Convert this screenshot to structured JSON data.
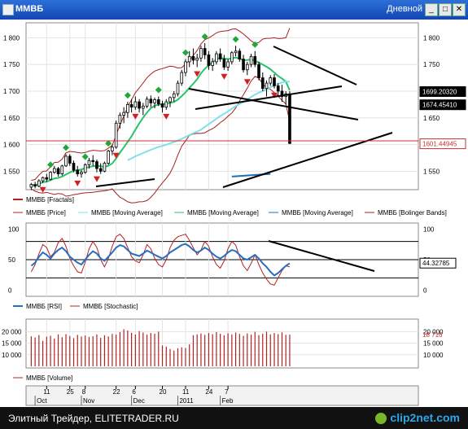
{
  "window": {
    "title": "ММВБ",
    "period": "Дневной"
  },
  "footer": {
    "text": "Элитный Трейдер, ELITETRADER.RU",
    "logo": "clip2net.com"
  },
  "chart_data": [
    {
      "type": "line",
      "name": "price",
      "y_ticks": [
        "1 800",
        "1 750",
        "1 700",
        "1 650",
        "1 600",
        "1 550"
      ],
      "y_tick_values": [
        1800,
        1750,
        1700,
        1650,
        1600,
        1550
      ],
      "ylim": [
        1520,
        1825
      ],
      "x_count": 100,
      "candles": [
        [
          1520,
          1528,
          1515,
          1525
        ],
        [
          1525,
          1530,
          1518,
          1522
        ],
        [
          1522,
          1535,
          1520,
          1532
        ],
        [
          1532,
          1540,
          1528,
          1538
        ],
        [
          1538,
          1545,
          1530,
          1535
        ],
        [
          1535,
          1550,
          1533,
          1548
        ],
        [
          1548,
          1560,
          1545,
          1555
        ],
        [
          1555,
          1558,
          1540,
          1545
        ],
        [
          1545,
          1562,
          1542,
          1560
        ],
        [
          1560,
          1582,
          1558,
          1578
        ],
        [
          1578,
          1582,
          1560,
          1565
        ],
        [
          1565,
          1570,
          1548,
          1552
        ],
        [
          1552,
          1560,
          1540,
          1545
        ],
        [
          1545,
          1552,
          1538,
          1548
        ],
        [
          1548,
          1565,
          1545,
          1562
        ],
        [
          1562,
          1575,
          1555,
          1570
        ],
        [
          1570,
          1580,
          1560,
          1568
        ],
        [
          1568,
          1572,
          1548,
          1555
        ],
        [
          1555,
          1565,
          1545,
          1550
        ],
        [
          1550,
          1568,
          1548,
          1565
        ],
        [
          1565,
          1590,
          1562,
          1588
        ],
        [
          1588,
          1600,
          1580,
          1595
        ],
        [
          1595,
          1645,
          1592,
          1640
        ],
        [
          1640,
          1660,
          1630,
          1655
        ],
        [
          1655,
          1670,
          1640,
          1660
        ],
        [
          1660,
          1680,
          1650,
          1675
        ],
        [
          1675,
          1685,
          1660,
          1670
        ],
        [
          1670,
          1690,
          1665,
          1680
        ],
        [
          1680,
          1685,
          1660,
          1668
        ],
        [
          1668,
          1678,
          1655,
          1672
        ],
        [
          1672,
          1690,
          1668,
          1685
        ],
        [
          1685,
          1692,
          1670,
          1678
        ],
        [
          1678,
          1688,
          1668,
          1684
        ],
        [
          1684,
          1690,
          1672,
          1676
        ],
        [
          1676,
          1682,
          1660,
          1670
        ],
        [
          1670,
          1685,
          1665,
          1680
        ],
        [
          1680,
          1690,
          1670,
          1688
        ],
        [
          1688,
          1700,
          1680,
          1695
        ],
        [
          1695,
          1720,
          1690,
          1715
        ],
        [
          1715,
          1740,
          1710,
          1735
        ],
        [
          1735,
          1760,
          1728,
          1755
        ],
        [
          1755,
          1775,
          1745,
          1765
        ],
        [
          1765,
          1780,
          1750,
          1758
        ],
        [
          1758,
          1770,
          1745,
          1762
        ],
        [
          1762,
          1785,
          1755,
          1780
        ],
        [
          1780,
          1790,
          1760,
          1768
        ],
        [
          1768,
          1775,
          1740,
          1748
        ],
        [
          1748,
          1762,
          1738,
          1755
        ],
        [
          1755,
          1775,
          1750,
          1770
        ],
        [
          1770,
          1780,
          1755,
          1760
        ],
        [
          1760,
          1768,
          1740,
          1745
        ],
        [
          1745,
          1760,
          1738,
          1755
        ],
        [
          1755,
          1775,
          1750,
          1772
        ],
        [
          1772,
          1785,
          1765,
          1775
        ],
        [
          1775,
          1780,
          1755,
          1760
        ],
        [
          1760,
          1768,
          1735,
          1740
        ],
        [
          1740,
          1755,
          1730,
          1750
        ],
        [
          1750,
          1770,
          1745,
          1765
        ],
        [
          1765,
          1775,
          1745,
          1750
        ],
        [
          1750,
          1755,
          1720,
          1725
        ],
        [
          1725,
          1735,
          1700,
          1705
        ],
        [
          1705,
          1720,
          1690,
          1715
        ],
        [
          1715,
          1730,
          1710,
          1725
        ],
        [
          1725,
          1732,
          1705,
          1710
        ],
        [
          1710,
          1715,
          1690,
          1700
        ],
        [
          1700,
          1712,
          1680,
          1690
        ],
        [
          1690,
          1700,
          1675,
          1695
        ],
        [
          1695,
          1700,
          1601,
          1602
        ]
      ],
      "fractals_up_idx": [
        5,
        9,
        14,
        20,
        25,
        33,
        40,
        45,
        53,
        58
      ],
      "fractals_down_idx": [
        3,
        12,
        17,
        22,
        27,
        35,
        43,
        50,
        56,
        63
      ],
      "price_labels": [
        "1699.20320",
        "1674.45410",
        "1601.44945"
      ],
      "price_label_values": [
        1699.2,
        1674.45,
        1601.45
      ]
    },
    {
      "type": "line",
      "name": "oscillators",
      "y_ticks": [
        "100",
        "50",
        "0"
      ],
      "y_tick_values": [
        100,
        50,
        0
      ],
      "ylim": [
        -5,
        105
      ],
      "levels": [
        80,
        50,
        20
      ],
      "value_label": "44.32785",
      "value": 44.33,
      "rsi": [
        40,
        45,
        55,
        62,
        58,
        52,
        60,
        66,
        70,
        64,
        55,
        50,
        45,
        42,
        50,
        58,
        64,
        60,
        52,
        48,
        55,
        62,
        70,
        74,
        72,
        66,
        60,
        58,
        56,
        60,
        65,
        62,
        58,
        55,
        52,
        56,
        62,
        66,
        70,
        74,
        76,
        72,
        66,
        62,
        65,
        70,
        66,
        60,
        55,
        52,
        56,
        62,
        66,
        64,
        58,
        52,
        50,
        54,
        58,
        52,
        44,
        38,
        30,
        24,
        28,
        34,
        40,
        44
      ],
      "stochastic": [
        30,
        42,
        60,
        75,
        70,
        55,
        62,
        78,
        85,
        72,
        52,
        40,
        30,
        28,
        46,
        68,
        80,
        70,
        50,
        38,
        52,
        72,
        88,
        92,
        85,
        70,
        55,
        48,
        45,
        58,
        75,
        68,
        52,
        42,
        38,
        50,
        70,
        82,
        88,
        90,
        92,
        82,
        70,
        58,
        66,
        80,
        72,
        55,
        42,
        36,
        48,
        68,
        80,
        74,
        55,
        40,
        32,
        44,
        58,
        42,
        28,
        18,
        10,
        8,
        20,
        32,
        40,
        38
      ]
    },
    {
      "type": "bar",
      "name": "volume",
      "y_ticks": [
        "20 000",
        "15 000",
        "10 000"
      ],
      "y_tick_values": [
        20000,
        15000,
        10000
      ],
      "ylim": [
        5000,
        24000
      ],
      "value_label": "18 716",
      "value": 18716,
      "values": [
        18000,
        17500,
        18500,
        16000,
        17800,
        18200,
        17000,
        18800,
        17600,
        18900,
        18100,
        17200,
        18600,
        17900,
        18300,
        17700,
        18000,
        18800,
        17300,
        18400,
        17900,
        19000,
        18700,
        19800,
        21000,
        20500,
        19500,
        18800,
        20200,
        19600,
        18700,
        19400,
        19100,
        20000,
        14000,
        13500,
        12500,
        11800,
        12800,
        13200,
        12900,
        14500,
        18500,
        18800,
        19200,
        18600,
        19400,
        18900,
        19800,
        19100,
        18400,
        19300,
        18800,
        19600,
        19000,
        18200,
        19200,
        18700,
        19900,
        18500,
        19100,
        20000,
        18800,
        19400,
        18900,
        19700,
        18600,
        18716
      ]
    },
    {
      "type": "axis",
      "x_tick_labels": [
        "11",
        "25",
        "8",
        "22",
        "6",
        "20",
        "11",
        "24",
        "7"
      ],
      "x_tick_idx": [
        4,
        10,
        14,
        22,
        27,
        34,
        40,
        46,
        51
      ],
      "month_labels": [
        "Oct",
        "Nov",
        "Dec",
        "2011",
        "Feb"
      ],
      "month_idx": [
        1,
        13,
        26,
        38,
        49
      ]
    }
  ],
  "legend": {
    "price_panel": [
      "ММВБ [Fractals]",
      "ММВБ [Price]",
      "ММВБ [Moving Average]",
      "ММВБ [Moving Average]",
      "ММВБ [Moving Average]",
      "ММВБ [Bolinger Bands]"
    ],
    "osc_panel": [
      "ММВБ [RSI]",
      "ММВБ [Stochastic]"
    ],
    "vol_panel": [
      "ММВБ [Volume]"
    ]
  },
  "colors": {
    "bull": "#ffffff",
    "bear": "#000000",
    "fractal_up": "#1fa83a",
    "fractal_down": "#d22020",
    "ma_fast": "#28c36a",
    "ma_slow": "#7fe0ea",
    "ma_long": "#1f6fb8",
    "bollinger": "#a52020",
    "rsi": "#2a6fbf",
    "stoch": "#b22222",
    "volume": "#b22222",
    "trend": "#000000"
  }
}
